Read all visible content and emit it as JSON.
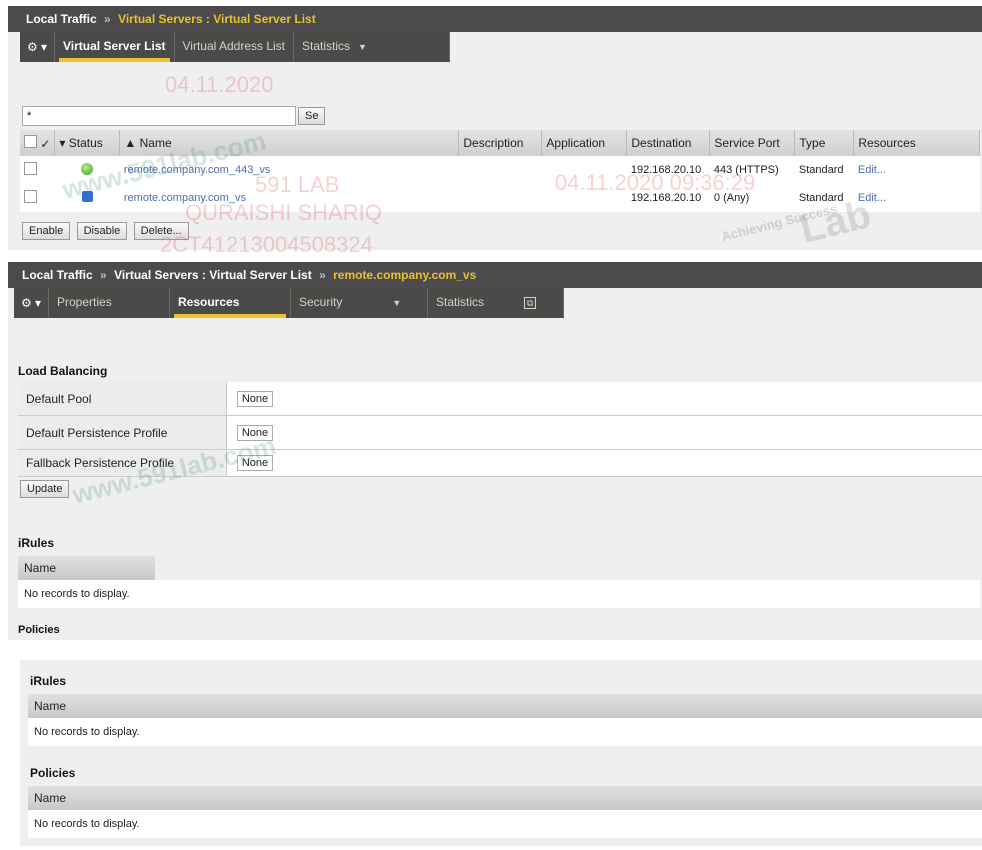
{
  "panel1": {
    "breadcrumb": {
      "root": "Local Traffic",
      "sep": "»",
      "current": "Virtual Servers : Virtual Server List"
    },
    "tabs": [
      {
        "label": "Virtual Server List"
      },
      {
        "label": "Virtual Address List"
      },
      {
        "label": "Statistics"
      }
    ],
    "search": {
      "value": "*",
      "button": "Se"
    },
    "columns": [
      "Status",
      "▲ Name",
      "Description",
      "Application",
      "Destination",
      "Service Port",
      "Type",
      "Resources"
    ],
    "rows": [
      {
        "name": "remote.company.com_443_vs",
        "destination": "192.168.20.10",
        "port": "443 (HTTPS)",
        "type": "Standard",
        "resources": "Edit..."
      },
      {
        "name": "remote.company.com_vs",
        "destination": "192.168.20.10",
        "port": "0 (Any)",
        "type": "Standard",
        "resources": "Edit..."
      }
    ],
    "actions": [
      "Enable",
      "Disable",
      "Delete..."
    ]
  },
  "panel2": {
    "breadcrumb": {
      "root": "Local Traffic",
      "sep": "»",
      "mid": "Virtual Servers : Virtual Server List",
      "current": "remote.company.com_vs"
    },
    "tabs": [
      {
        "label": "Properties"
      },
      {
        "label": "Resources"
      },
      {
        "label": "Security"
      },
      {
        "label": "Statistics"
      }
    ],
    "load_balancing": {
      "title": "Load Balancing",
      "rows": [
        {
          "label": "Default Pool",
          "value": "None"
        },
        {
          "label": "Default Persistence Profile",
          "value": "None"
        },
        {
          "label": "Fallback Persistence Profile",
          "value": "None"
        }
      ],
      "update": "Update"
    },
    "irules": {
      "title": "iRules",
      "column": "Name",
      "empty": "No records to display."
    },
    "policies_title": "Policies"
  },
  "panel3": {
    "irules": {
      "title": "iRules",
      "column": "Name",
      "empty": "No records to display."
    },
    "policies": {
      "title": "Policies",
      "column": "Name",
      "empty": "No records to display."
    }
  },
  "watermarks": [
    "04.11.2020",
    "591 LAB",
    "QURAISHI SHARIQ",
    "2CT41213004508324",
    "04.11.2020 09:36:29",
    "www.591lab.com",
    "Lab",
    "Achieving Success"
  ]
}
